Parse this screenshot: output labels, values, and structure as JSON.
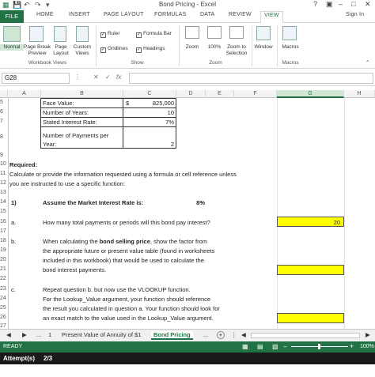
{
  "window": {
    "title": "Bond Pricing - Excel",
    "sign_in": "Sign In",
    "help": "?"
  },
  "tabs": [
    "FILE",
    "HOME",
    "INSERT",
    "PAGE LAYOUT",
    "FORMULAS",
    "DATA",
    "REVIEW",
    "VIEW"
  ],
  "ribbon": {
    "normal": "Normal",
    "page_break_1": "Page Break",
    "page_break_2": "Preview",
    "page_layout_1": "Page",
    "page_layout_2": "Layout",
    "custom_1": "Custom",
    "custom_2": "Views",
    "ruler": "Ruler",
    "formula_bar": "Formula Bar",
    "gridlines": "Gridlines",
    "headings": "Headings",
    "zoom": "Zoom",
    "zoom100": "100%",
    "zoom_sel_1": "Zoom to",
    "zoom_sel_2": "Selection",
    "window": "Window",
    "macros": "Macros",
    "grp_workbook": "Workbook Views",
    "grp_show": "Show",
    "grp_zoom": "Zoom",
    "grp_macros": "Macros"
  },
  "formula_bar": {
    "name_box": "G28",
    "fx": "fx",
    "value": ""
  },
  "columns": [
    "A",
    "B",
    "C",
    "D",
    "E",
    "F",
    "G",
    "H"
  ],
  "rows": [
    "5",
    "6",
    "7",
    "",
    "8",
    "",
    "9",
    "10",
    "11",
    "12",
    "13",
    "14",
    "15",
    "16",
    "17",
    "18",
    "19",
    "20",
    "21",
    "22",
    "23",
    "24",
    "25",
    "26",
    "27"
  ],
  "cells": {
    "face_label": "Face Value:",
    "face_cur": "$",
    "face_val": "825,000",
    "years_label": "Number of Years:",
    "years_val": "10",
    "rate_label": "Stated Interest Rate:",
    "rate_val": "7%",
    "npay_label1": "Number of Payments per",
    "npay_label2": "Year:",
    "npay_val": "2",
    "required": "Required:",
    "instr1": "Calculate or provide the information requested using a formula or cell reference unless",
    "instr2": "you are instructed to use a specific function:",
    "q1_num": "1)",
    "q1_text": "Assume the Market Interest Rate is:",
    "q1_val": "8%",
    "qa_num": "a.",
    "qa_text": "How many total payments or periods will this bond pay interest?",
    "qa_val": "20",
    "qb_num": "b.",
    "qb_1_pre": "When calculating the ",
    "qb_1_bold": "bond selling price",
    "qb_1_post": ", show the factor from",
    "qb_2": "the appropriate future or present value table (found in worksheets",
    "qb_3": "included in this workbook) that would be used to calculate the",
    "qb_4": "bond interest payments.",
    "qc_num": "c.",
    "qc_1": "Repeat question b. but now use the VLOOKUP function.",
    "qc_2": "For the Lookup_Value argument, your function should reference",
    "qc_3": "the result you calculated in question a.  Your function should look for",
    "qc_4": "an exact match to the value used in the Lookup_Value argument."
  },
  "sheet_tabs": {
    "ellipsis": "...",
    "first": "1",
    "second": "Present Value of Annuity of $1",
    "active": "Bond Pricing",
    "more": "...",
    "add": "+"
  },
  "status": {
    "ready": "READY",
    "zoom": "100%"
  },
  "attempts": {
    "label": "Attempt(s)",
    "value": "2/3"
  },
  "colors": {
    "excel_green": "#217346",
    "highlight": "#ffff00"
  }
}
